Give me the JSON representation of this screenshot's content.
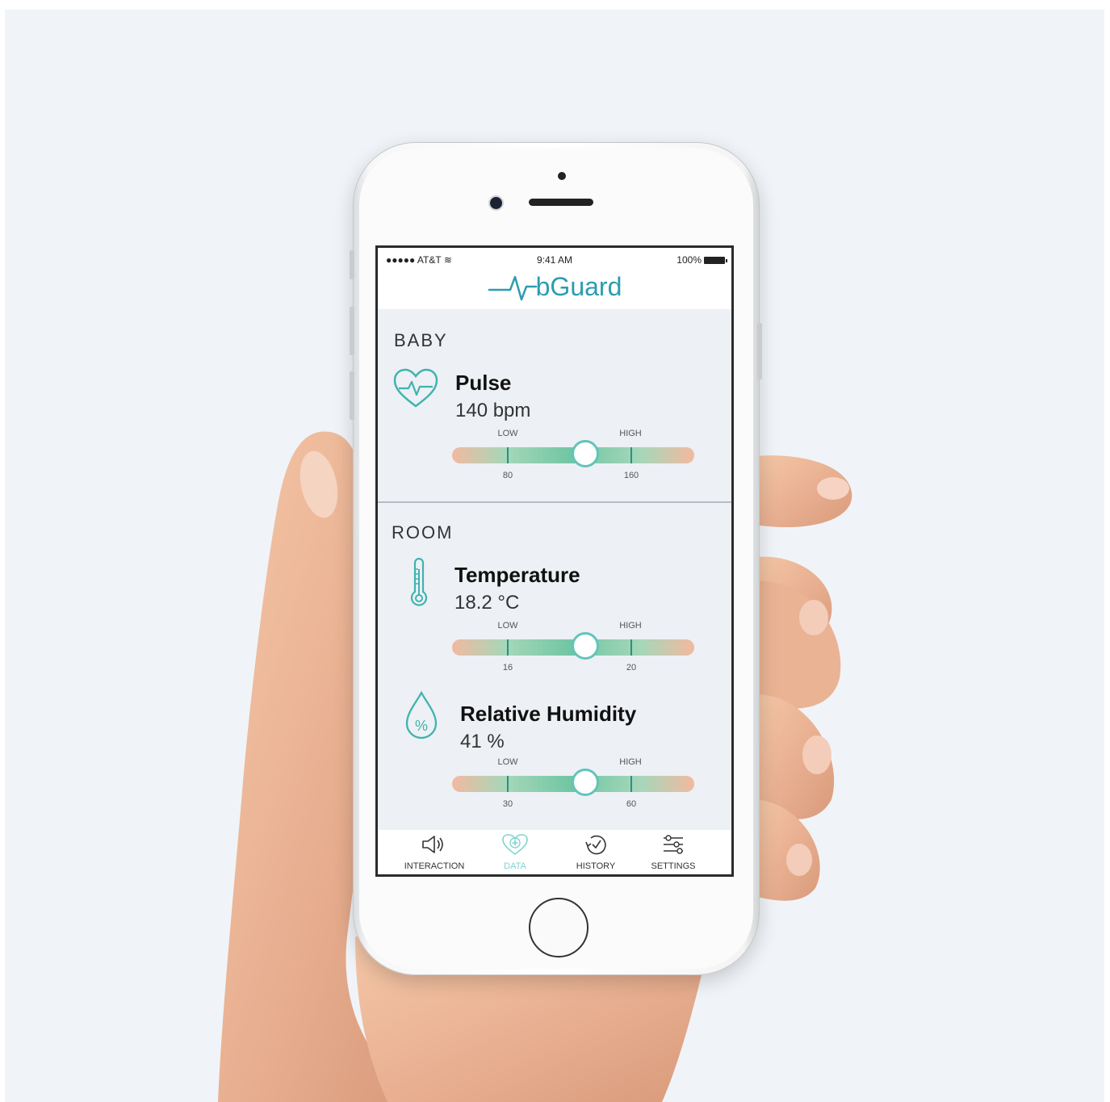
{
  "status": {
    "carrier": "●●●●● AT&T",
    "time": "9:41 AM",
    "battery": "100%"
  },
  "app": {
    "logo_text": "bGuard",
    "accent_color": "#2b9db0"
  },
  "baby": {
    "title": "BABY",
    "pulse": {
      "name": "Pulse",
      "value": "140 bpm",
      "icon": "heart-pulse-icon",
      "low_label": "LOW",
      "high_label": "HIGH",
      "low": "80",
      "high": "160",
      "level": 0.55
    }
  },
  "room": {
    "title": "ROOM",
    "temperature": {
      "name": "Temperature",
      "value": "18.2 °C",
      "icon": "thermometer-icon",
      "low_label": "LOW",
      "high_label": "HIGH",
      "low": "16",
      "high": "20",
      "level": 0.55
    },
    "humidity": {
      "name": "Relative Humidity",
      "value": "41 %",
      "icon": "humidity-drop-icon",
      "low_label": "LOW",
      "high_label": "HIGH",
      "low": "30",
      "high": "60",
      "level": 0.55
    }
  },
  "tabs": [
    {
      "label": "INTERACTION",
      "icon": "speaker-icon",
      "active": false
    },
    {
      "label": "DATA",
      "icon": "heart-plus-icon",
      "active": true
    },
    {
      "label": "HISTORY",
      "icon": "history-icon",
      "active": false
    },
    {
      "label": "SETTINGS",
      "icon": "sliders-icon",
      "active": false
    }
  ]
}
